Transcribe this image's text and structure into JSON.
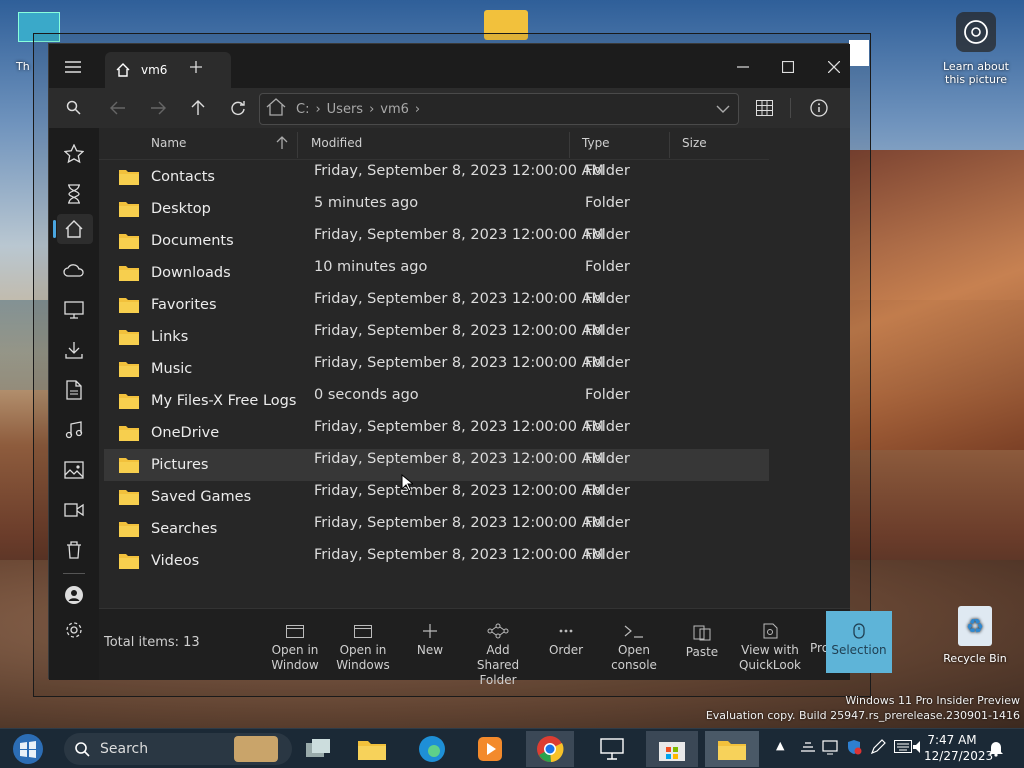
{
  "desktop": {
    "learn_label_1": "Learn about",
    "learn_label_2": "this picture",
    "recycle_label": "Recycle Bin",
    "partial_label": "Th",
    "watermark_1": "Windows 11 Pro Insider Preview",
    "watermark_2": "Evaluation copy. Build 25947.rs_prerelease.230901-1416"
  },
  "window": {
    "tab_title": "vm6",
    "address": {
      "crumbs": [
        "C:",
        "Users",
        "vm6"
      ],
      "separator": "›"
    },
    "columns": {
      "name": "Name",
      "modified": "Modified",
      "type": "Type",
      "size": "Size"
    },
    "files": [
      {
        "name": "Contacts",
        "modified": "Friday, September 8, 2023 12:00:00 AM",
        "type": "Folder"
      },
      {
        "name": "Desktop",
        "modified": "5 minutes ago",
        "type": "Folder"
      },
      {
        "name": "Documents",
        "modified": "Friday, September 8, 2023 12:00:00 AM",
        "type": "Folder"
      },
      {
        "name": "Downloads",
        "modified": "10 minutes ago",
        "type": "Folder"
      },
      {
        "name": "Favorites",
        "modified": "Friday, September 8, 2023 12:00:00 AM",
        "type": "Folder"
      },
      {
        "name": "Links",
        "modified": "Friday, September 8, 2023 12:00:00 AM",
        "type": "Folder"
      },
      {
        "name": "Music",
        "modified": "Friday, September 8, 2023 12:00:00 AM",
        "type": "Folder"
      },
      {
        "name": "My Files-X Free Logs",
        "modified": "0 seconds ago",
        "type": "Folder"
      },
      {
        "name": "OneDrive",
        "modified": "Friday, September 8, 2023 12:00:00 AM",
        "type": "Folder"
      },
      {
        "name": "Pictures",
        "modified": "Friday, September 8, 2023 12:00:00 AM",
        "type": "Folder"
      },
      {
        "name": "Saved Games",
        "modified": "Friday, September 8, 2023 12:00:00 AM",
        "type": "Folder"
      },
      {
        "name": "Searches",
        "modified": "Friday, September 8, 2023 12:00:00 AM",
        "type": "Folder"
      },
      {
        "name": "Videos",
        "modified": "Friday, September 8, 2023 12:00:00 AM",
        "type": "Folder"
      }
    ],
    "status": "Total items: 13",
    "actions": {
      "open_window_1": "Open in",
      "open_window_2": "Window",
      "open_windows_1": "Open in",
      "open_windows_2": "Windows",
      "new": "New",
      "add_shared_1": "Add Shared",
      "add_shared_2": "Folder",
      "order": "Order",
      "console_1": "Open",
      "console_2": "console",
      "paste": "Paste",
      "quicklook_1": "View with",
      "quicklook_2": "QuickLook",
      "partial": "Pro",
      "selection": "Selection"
    },
    "colors": {
      "folder": "#f2c13c",
      "selection": "#5eb4d8",
      "accent": "#4aa6e0"
    }
  },
  "taskbar": {
    "search": "Search",
    "time": "7:47 AM",
    "date": "12/27/2023"
  }
}
